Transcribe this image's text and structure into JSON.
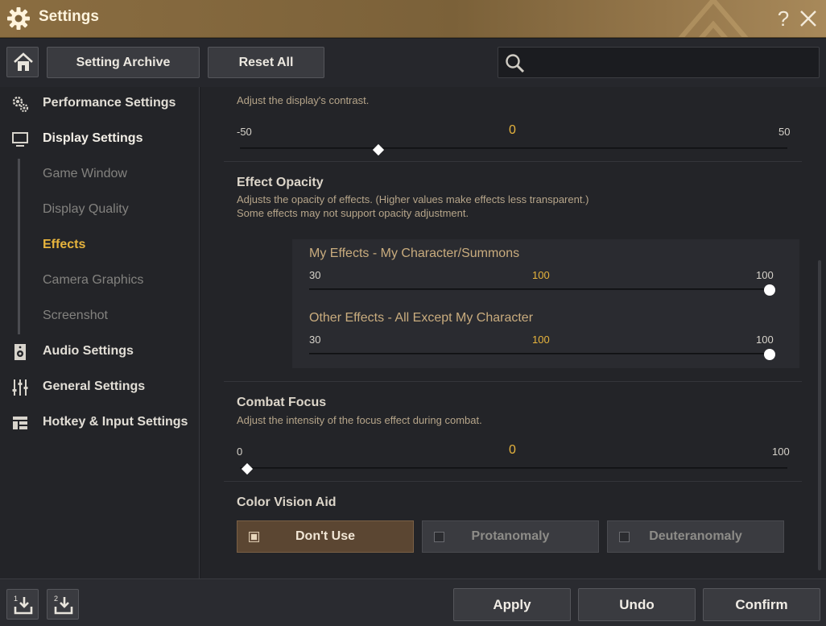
{
  "window": {
    "title": "Settings"
  },
  "toolbar": {
    "setting_archive": "Setting Archive",
    "reset_all": "Reset All",
    "search_placeholder": ""
  },
  "sidebar": {
    "items": [
      {
        "label": "Performance Settings",
        "icon": "gears-icon"
      },
      {
        "label": "Display Settings",
        "icon": "monitor-icon"
      },
      {
        "label": "Audio Settings",
        "icon": "speaker-icon"
      },
      {
        "label": "General Settings",
        "icon": "sliders-icon"
      },
      {
        "label": "Hotkey & Input Settings",
        "icon": "layout-icon"
      }
    ],
    "display_subitems": [
      {
        "label": "Game Window",
        "active": false
      },
      {
        "label": "Display Quality",
        "active": false
      },
      {
        "label": "Effects",
        "active": true
      },
      {
        "label": "Camera Graphics",
        "active": false
      },
      {
        "label": "Screenshot",
        "active": false
      }
    ]
  },
  "content": {
    "contrast": {
      "desc": "Adjust the display's contrast.",
      "min": "-50",
      "value": "0",
      "max": "50",
      "value_num": 0,
      "min_num": -50,
      "max_num": 50
    },
    "effect_opacity": {
      "title": "Effect Opacity",
      "desc1": "Adjusts the opacity of effects. (Higher values make effects less transparent.)",
      "desc2": "Some effects may not support opacity adjustment.",
      "my_effects": {
        "title": "My Effects - My Character/Summons",
        "min": "30",
        "value": "100",
        "max": "100",
        "fraction": 1.0
      },
      "other_effects": {
        "title": "Other Effects - All Except My Character",
        "min": "30",
        "value": "100",
        "max": "100",
        "fraction": 1.0
      }
    },
    "combat_focus": {
      "title": "Combat Focus",
      "desc": "Adjust the intensity of the focus effect during combat.",
      "min": "0",
      "value": "0",
      "max": "100",
      "fraction": 0.0
    },
    "color_vision": {
      "title": "Color Vision Aid",
      "options": [
        {
          "label": "Don't Use",
          "selected": true
        },
        {
          "label": "Protanomaly",
          "selected": false
        },
        {
          "label": "Deuteranomaly",
          "selected": false
        }
      ]
    }
  },
  "footer": {
    "apply": "Apply",
    "undo": "Undo",
    "confirm": "Confirm",
    "slot1": "1",
    "slot2": "2"
  },
  "colors": {
    "accent": "#e7b43d",
    "titlebar": "#8a6d41",
    "selected_option": "#5b4632"
  }
}
